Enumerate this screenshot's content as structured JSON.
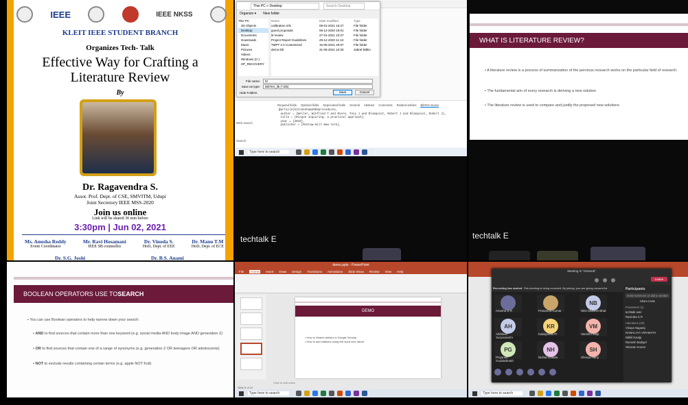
{
  "poster": {
    "logos": [
      "IEEE",
      "IEEE NKSS"
    ],
    "branch": "KLEIT IEEE STUDENT BRANCH",
    "organizes": "Organizes Tech- Talk",
    "title_line1": "Effective Way for Crafting a",
    "title_line2": "Literature Review",
    "by": "By",
    "speaker": "Dr. Ragavendra S.",
    "speaker_role1": "Assot. Prof. Dept. of CSE, SMVITM, Udupi",
    "speaker_role2": "Joint Secretory IEEE MSS-2020",
    "join": "Join us online",
    "link_note": "Link will be shared 30 min before",
    "time": "3:30pm",
    "date": "Jun 02, 2021",
    "coordinators": [
      {
        "name": "Ms. Anusha Reddy",
        "role": "Event Coordinator"
      },
      {
        "name": "Mr. Ravi Hosamani",
        "role": "IEEE SB counsellor"
      },
      {
        "name": "Dr. Vinoda S.",
        "role": "HoD, Dept. of EEE"
      },
      {
        "name": "Dr. Manu T.M",
        "role": "HoD, Dept. of ECE"
      }
    ],
    "bottom_names": [
      "Dr. S.G. Joshi",
      "Dr. B.S. Anami"
    ]
  },
  "explorer": {
    "breadcrumb": "This PC > Desktop",
    "search_placeholder": "Search Desktop",
    "organize": "Organize ▾",
    "new_folder": "New folder",
    "columns": [
      "Name",
      "Date modified",
      "Type"
    ],
    "files": [
      [
        "calibration.mfx",
        "08-01-2021 16:27",
        "File folder"
      ],
      [
        "guest proposals",
        "08-12-2020 19:01",
        "File folder"
      ],
      [
        "lit review",
        "27-01-2021 10:27",
        "File folder"
      ],
      [
        "Project Report Guidelines",
        "29-12-2020 11:13",
        "File folder"
      ],
      [
        "TMPT 2.0 Customized",
        "15-05-2021 20:57",
        "File folder"
      ],
      [
        "demo.bib",
        "31-05-2021 10:30",
        "Jabref Biblio"
      ]
    ],
    "nav": [
      "This PC",
      "3D Objects",
      "Desktop",
      "Documents",
      "Downloads",
      "Music",
      "Pictures",
      "Videos",
      "Windows (C:)",
      "HP_RECOVERY"
    ],
    "file_name_label": "File name:",
    "file_name": "M",
    "save_type_label": "Save as type:",
    "save_type": "BibTeX_lib (*.bib)",
    "hide_folders": "Hide Folders",
    "save": "Save",
    "cancel": "Cancel",
    "tabs": [
      "Required fields",
      "Optional fields",
      "Deprecated fields",
      "General",
      "Abstract",
      "Comments",
      "Related articles",
      "BibTeX source"
    ],
    "bib": "@article{kitchenham2004procedures,\n author = {Weller, Winfried T and Moore, Tony J and Blomqvist, Robert J and Blomqvist, Robert J},\n title = {Risque inquiring: a practical approach},\n year = {2019},\n publisher = {McGraw-Hill New York},",
    "webSearch": "Web search",
    "search_field": "Search",
    "taskbar_search": "Type here to search"
  },
  "lit_slide": {
    "title": "WHAT IS LITERATURE REVIEW?",
    "bullets": [
      "A literature review is a process of summarization of the pervious research works on the particular field of research.",
      "The fundamental aim of every research is deriving a new solution",
      "The literature review is used to compare and justify the proposed new solutions"
    ]
  },
  "techtalk_labels": [
    "techtalk E",
    "techtalk E"
  ],
  "bool_slide": {
    "title_pre": "BOOLEAN OPERATORS USE TO ",
    "title_bold": "SEARCH",
    "intro": "You can use Boolean operators to help narrow down your search:",
    "items": [
      {
        "k": "AND",
        "t": " to find sources that contain more than one keyword (e.g. social media AND body image AND generation Z)"
      },
      {
        "k": "OR",
        "t": " to find sources that contain one of a range of synonyms (e.g. generation Z OR teenagers OR adolescents)"
      },
      {
        "k": "NOT",
        "t": " to exclude results containing certain terms (e.g. apple NOT fruit)"
      }
    ]
  },
  "ppt": {
    "app_title": "demo.pptx - PowerPoint",
    "menu": [
      "File",
      "Home",
      "Insert",
      "Draw",
      "Design",
      "Transitions",
      "Animations",
      "Slide Show",
      "Review",
      "View",
      "Help"
    ],
    "slide_title": "DEMO",
    "bullets": [
      "How to Search articles in Google Scholar",
      "How to add citations using MS word and Jabref"
    ],
    "notes": "Click to add notes",
    "taskbar_search": "Type here to search",
    "slide_count": "Slide 5 of 12"
  },
  "teams": {
    "window_title": "Meeting in \"General\"",
    "recording": "Recording has started.",
    "recording_sub": "This meeting is being recorded. By joining, you are giving consent for",
    "leave": "Leave",
    "participants_title": "Participants",
    "invite_placeholder": "Invite someone or dial a number",
    "share_invite": "Share invite",
    "presenters": "Presenters (2)",
    "attendees": "Attendees (20)",
    "tiles": [
      {
        "label": "Anusha S R",
        "init": ""
      },
      {
        "label": "Prasanna Kumar",
        "init": ""
      },
      {
        "label": "Nitin Mukesh Bhat",
        "init": "NB"
      },
      {
        "label": "Abhilash Suryavanshi",
        "init": "AH"
      },
      {
        "label": "Kalaiyarasi Pr",
        "init": "KR"
      },
      {
        "label": "Vanishri Malji",
        "init": "VM"
      },
      {
        "label": "Priyanka Guddadmath",
        "init": "PG"
      },
      {
        "label": "Nishal Gowda",
        "init": "NH"
      },
      {
        "label": "Shreya Hanji",
        "init": "SH"
      }
    ],
    "people": [
      "techtalk user",
      "Ravindra S R",
      "Vinaya Nagaraj",
      "NAMALAYA VIRAMATH",
      "Nikhil Kaulgi",
      "Ramesh Badiger",
      "Shravan Kumar"
    ],
    "taskbar_search": "Type here to search"
  },
  "colors": {
    "banner": "#6b1a3a",
    "accent": "#f4a300",
    "ppt": "#b7472a",
    "teams": "#464775"
  }
}
